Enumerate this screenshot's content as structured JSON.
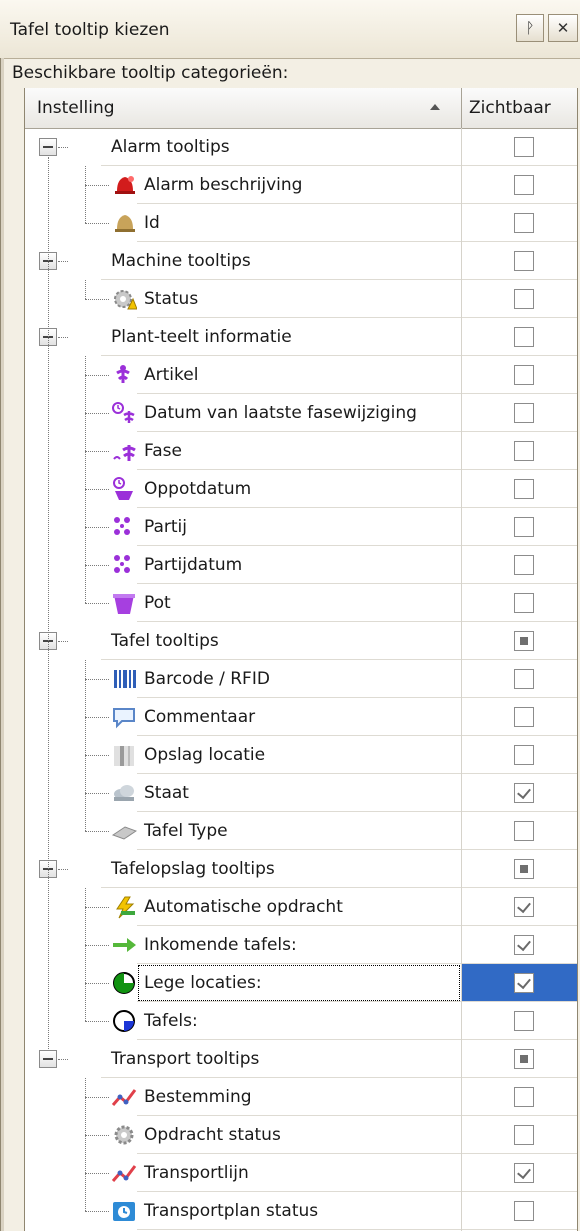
{
  "window": {
    "title": "Tafel tooltip kiezen",
    "pin_glyph": "ᚹ",
    "close_glyph": "✕"
  },
  "subheader": "Beschikbare tooltip categorieën:",
  "columns": {
    "setting": "Instelling",
    "visible": "Zichtbaar"
  },
  "rows": [
    {
      "type": "cat",
      "label": "Alarm tooltips",
      "state": "unchecked"
    },
    {
      "type": "child",
      "label": "Alarm beschrijving",
      "icon": "alarm-bell-red-icon",
      "state": "unchecked"
    },
    {
      "type": "child",
      "label": "Id",
      "icon": "bell-gold-icon",
      "state": "unchecked"
    },
    {
      "type": "cat",
      "label": "Machine tooltips",
      "state": "unchecked"
    },
    {
      "type": "child",
      "label": "Status",
      "icon": "gear-warning-icon",
      "state": "unchecked"
    },
    {
      "type": "cat",
      "label": "Plant-teelt informatie",
      "state": "unchecked"
    },
    {
      "type": "child",
      "label": "Artikel",
      "icon": "plant-purple-icon",
      "state": "unchecked"
    },
    {
      "type": "child",
      "label": "Datum van laatste fasewijziging",
      "icon": "plant-clock-icon",
      "state": "unchecked"
    },
    {
      "type": "child",
      "label": "Fase",
      "icon": "plant-growth-icon",
      "state": "unchecked"
    },
    {
      "type": "child",
      "label": "Oppotdatum",
      "icon": "pot-clock-icon",
      "state": "unchecked"
    },
    {
      "type": "child",
      "label": "Partij",
      "icon": "flowers-batch-icon",
      "state": "unchecked"
    },
    {
      "type": "child",
      "label": "Partijdatum",
      "icon": "flowers-batch-icon",
      "state": "unchecked"
    },
    {
      "type": "child",
      "label": "Pot",
      "icon": "pot-icon",
      "state": "unchecked"
    },
    {
      "type": "cat",
      "label": "Tafel tooltips",
      "state": "partial"
    },
    {
      "type": "child",
      "label": "Barcode / RFID",
      "icon": "barcode-icon",
      "state": "unchecked"
    },
    {
      "type": "child",
      "label": "Commentaar",
      "icon": "comment-bubble-icon",
      "state": "unchecked"
    },
    {
      "type": "child",
      "label": "Opslag locatie",
      "icon": "storage-location-icon",
      "state": "unchecked"
    },
    {
      "type": "child",
      "label": "Staat",
      "icon": "cloud-state-icon",
      "state": "checked"
    },
    {
      "type": "child",
      "label": "Tafel Type",
      "icon": "table-type-icon",
      "state": "unchecked"
    },
    {
      "type": "cat",
      "label": "Tafelopslag tooltips",
      "state": "partial"
    },
    {
      "type": "child",
      "label": "Automatische opdracht",
      "icon": "auto-command-icon",
      "state": "checked"
    },
    {
      "type": "child",
      "label": "Inkomende tafels:",
      "icon": "arrow-right-icon",
      "state": "checked"
    },
    {
      "type": "child",
      "label": "Lege locaties:",
      "icon": "green-pie-icon",
      "state": "checked",
      "selected": true
    },
    {
      "type": "child",
      "label": "Tafels:",
      "icon": "blue-pie-icon",
      "state": "unchecked"
    },
    {
      "type": "cat",
      "label": "Transport tooltips",
      "state": "partial"
    },
    {
      "type": "child",
      "label": "Bestemming",
      "icon": "route-line-icon",
      "state": "unchecked"
    },
    {
      "type": "child",
      "label": "Opdracht status",
      "icon": "gear-status-icon",
      "state": "unchecked"
    },
    {
      "type": "child",
      "label": "Transportlijn",
      "icon": "route-line-icon",
      "state": "checked"
    },
    {
      "type": "child",
      "label": "Transportplan status",
      "icon": "transport-plan-icon",
      "state": "unchecked"
    }
  ]
}
